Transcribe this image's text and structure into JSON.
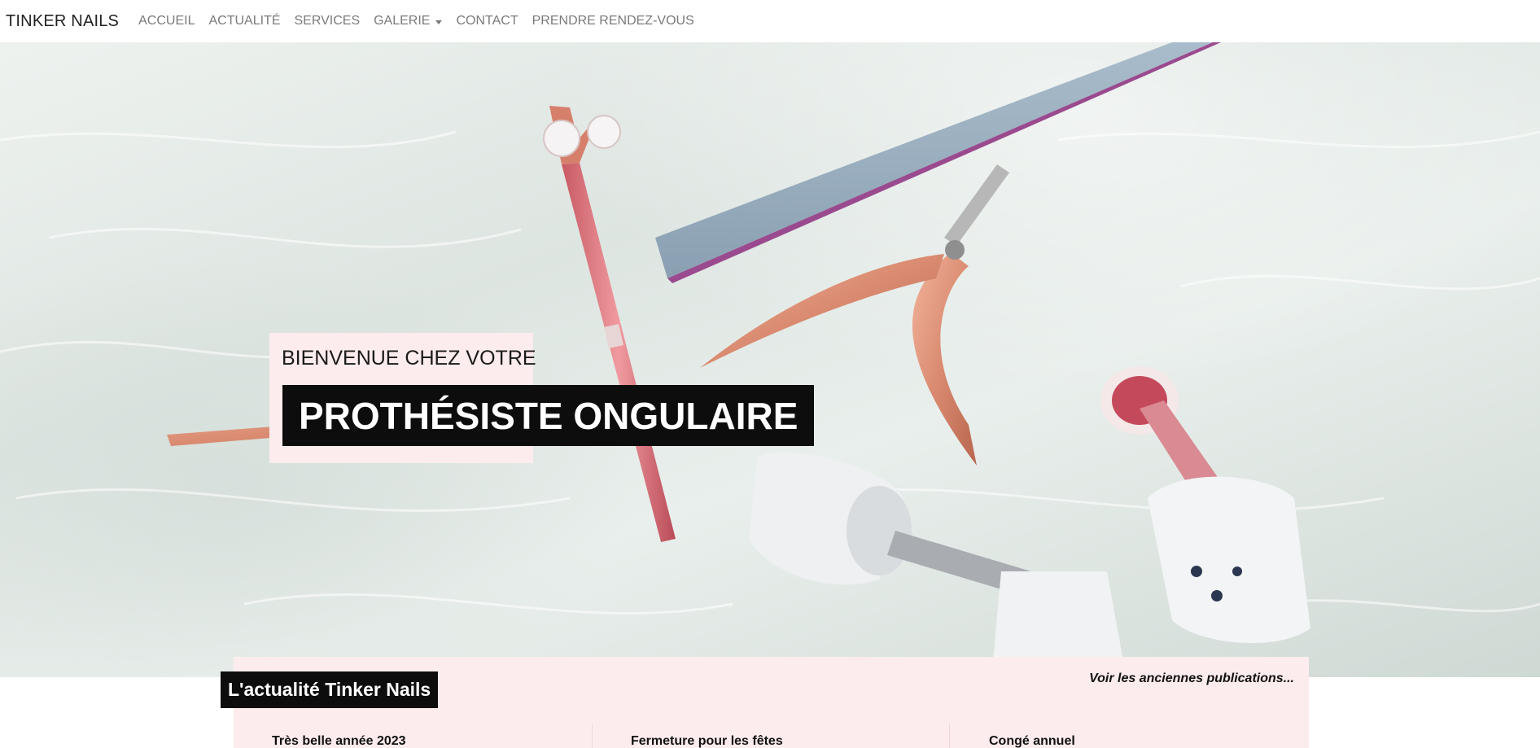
{
  "nav": {
    "brand": "TINKER NAILS",
    "items": [
      {
        "label": "ACCUEIL"
      },
      {
        "label": "ACTUALITÉ"
      },
      {
        "label": "SERVICES"
      },
      {
        "label": "GALERIE",
        "dropdown": true
      },
      {
        "label": "CONTACT"
      },
      {
        "label": "PRENDRE RENDEZ-VOUS"
      }
    ]
  },
  "hero": {
    "welcome_small": "BIENVENUE CHEZ VOTRE",
    "welcome_big": "PROTHÉSISTE ONGULAIRE",
    "image_semantic": "nail-tools-on-white-fur-photo"
  },
  "news": {
    "title": "L'actualité Tinker Nails",
    "more_link": "Voir les anciennes publications...",
    "cards": [
      {
        "title": "Très belle année 2023"
      },
      {
        "title": "Fermeture pour les fêtes"
      },
      {
        "title": "Congé annuel"
      }
    ]
  },
  "colors": {
    "pink_panel": "#fdeced",
    "black_label": "#0d0d0d",
    "nav_text": "#7a7a7a"
  }
}
